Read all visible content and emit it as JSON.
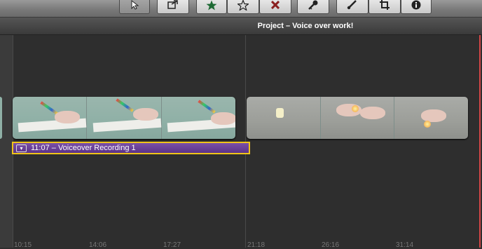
{
  "toolbar": {
    "buttons": [
      {
        "name": "select-arrow-icon"
      },
      {
        "name": "add-to-project-icon"
      },
      {
        "name": "mark-favorite-icon"
      },
      {
        "name": "unmark-icon"
      },
      {
        "name": "reject-icon"
      },
      {
        "name": "keyword-icon"
      },
      {
        "name": "audio-icon"
      },
      {
        "name": "crop-icon"
      },
      {
        "name": "info-icon"
      }
    ]
  },
  "project": {
    "title": "Project – Voice over work!"
  },
  "voiceover": {
    "label": "11:07 – Voiceover Recording 1"
  },
  "timeline": {
    "ticks": [
      "10:15",
      "14:06",
      "17:27",
      "21:18",
      "26:16",
      "31:14"
    ]
  },
  "colors": {
    "accent": "#f0c419",
    "voiceover": "#6a3e99",
    "playhead": "#d24646"
  }
}
